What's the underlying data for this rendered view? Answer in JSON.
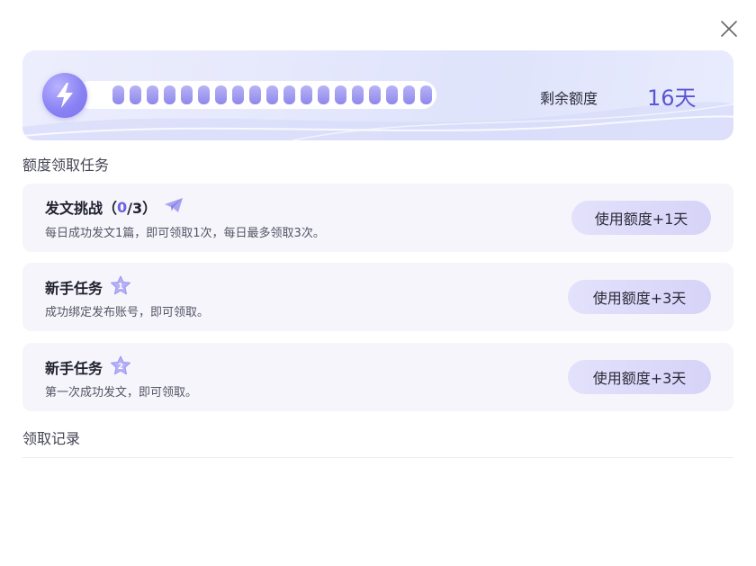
{
  "close_icon": "close-icon",
  "quota": {
    "remaining_label": "剩余额度",
    "remaining_value": "16天",
    "filled_cells": 19,
    "icon": "lightning-bolt-icon",
    "accent_color": "#5b54d6"
  },
  "sections": {
    "claim_title": "额度领取任务",
    "records_title": "领取记录"
  },
  "tasks": [
    {
      "title": "发文挑战（",
      "count_done": "0",
      "count_rest": "/3）",
      "icon": "paper-plane-icon",
      "description": "每日成功发文1篇，即可领取1次，每日最多领取3次。",
      "button_label": "使用额度+1天"
    },
    {
      "title": "新手任务",
      "badge_number": "1",
      "icon": "star-badge-icon",
      "description": "成功绑定发布账号，即可领取。",
      "button_label": "使用额度+3天"
    },
    {
      "title": "新手任务",
      "badge_number": "2",
      "icon": "star-badge-icon",
      "description": "第一次成功发文，即可领取。",
      "button_label": "使用额度+3天"
    }
  ]
}
